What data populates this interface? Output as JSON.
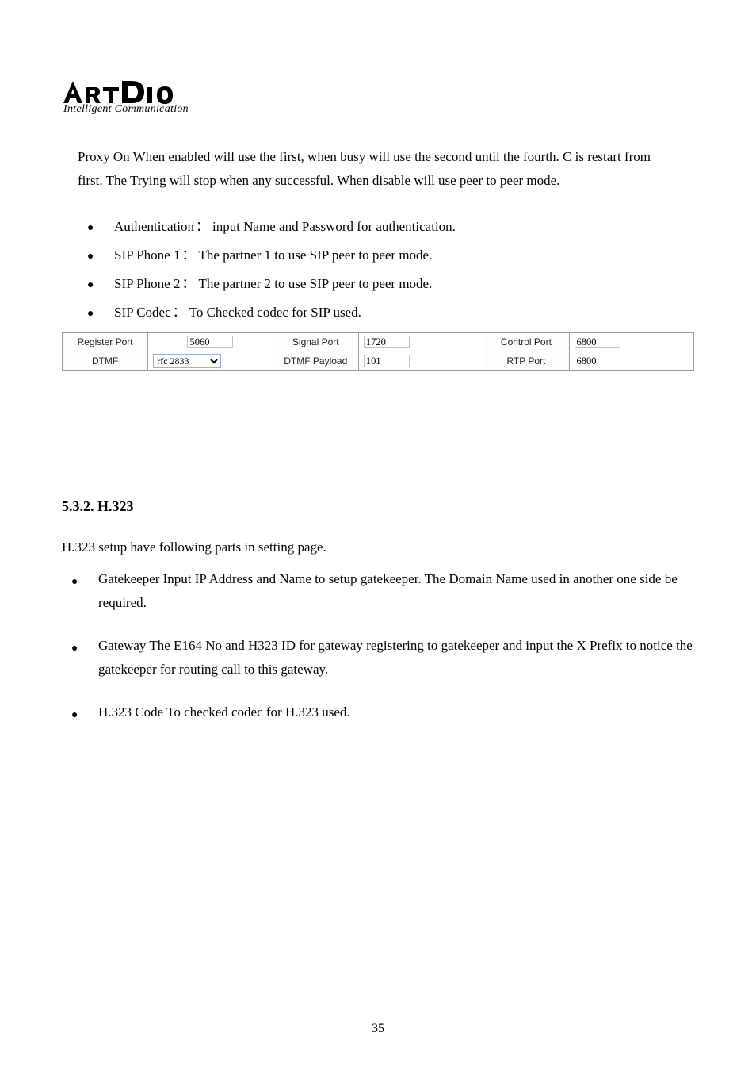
{
  "logo": {
    "text_main": "ARTDIO",
    "tagline": "Intelligent Communication"
  },
  "intro_paragraph": "Proxy On When enabled will use the first, when busy will use the second until the fourth. C is restart from first. The Trying will stop when any successful. When disable will use peer to peer mode.",
  "top_bullets": [
    {
      "label": "Authentication",
      "colon": "：",
      "desc": "input Name and Password for authentication."
    },
    {
      "label": "SIP Phone 1",
      "colon": "：",
      "desc": "The partner 1 to use SIP peer to peer mode."
    },
    {
      "label": "SIP Phone 2",
      "colon": "：",
      "desc": "The partner 2 to use SIP peer to peer mode."
    },
    {
      "label": "SIP Codec",
      "colon": "：",
      "desc": "To Checked codec for SIP used."
    }
  ],
  "settings": {
    "row1": {
      "c1_label": "Register Port",
      "c1_value": "5060",
      "c2_label": "Signal Port",
      "c2_value": "1720",
      "c3_label": "Control Port",
      "c3_value": "6800"
    },
    "row2": {
      "c1_label": "DTMF",
      "c1_option": "rfc 2833",
      "c2_label": "DTMF Payload",
      "c2_value": "101",
      "c3_label": "RTP Port",
      "c3_value": "6800"
    }
  },
  "h323": {
    "heading": "5.3.2.  H.323",
    "intro": "H.323 setup have following parts in setting page.",
    "items": [
      {
        "label": "Gatekeeper",
        "body": "Input IP Address and Name to setup gatekeeper. The Domain Name used in another one side be required."
      },
      {
        "label": "Gateway",
        "body": "The E164 No and H323 ID for gateway registering to gatekeeper and input the X Prefix to notice the gatekeeper for routing call to this gateway."
      },
      {
        "label": "H.323 Code",
        "body": "To checked codec for H.323 used."
      }
    ]
  },
  "page_number": "35"
}
